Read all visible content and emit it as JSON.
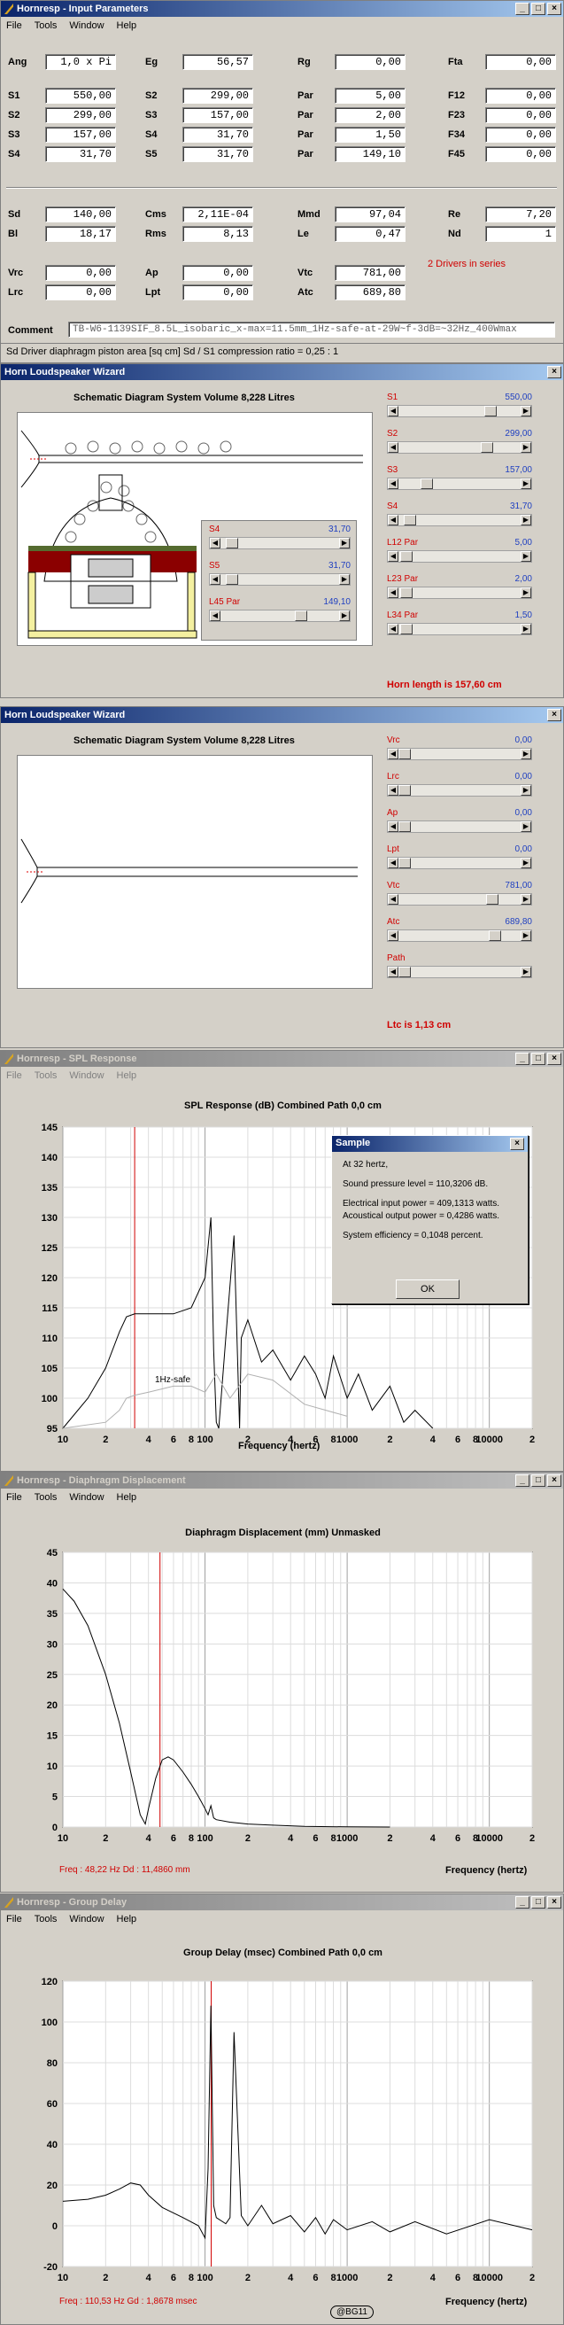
{
  "w1": {
    "title": "Hornresp - Input Parameters",
    "menu": [
      "File",
      "Tools",
      "Window",
      "Help"
    ],
    "params": [
      {
        "row": 0,
        "col": 0,
        "label": "Ang",
        "value": "1,0 x Pi"
      },
      {
        "row": 0,
        "col": 1,
        "label": "Eg",
        "value": "56,57"
      },
      {
        "row": 0,
        "col": 2,
        "label": "Rg",
        "value": "0,00"
      },
      {
        "row": 0,
        "col": 3,
        "label": "Fta",
        "value": "0,00"
      },
      {
        "row": 1,
        "col": 0,
        "label": "S1",
        "value": "550,00"
      },
      {
        "row": 1,
        "col": 1,
        "label": "S2",
        "value": "299,00"
      },
      {
        "row": 1,
        "col": 2,
        "label": "Par",
        "value": "5,00"
      },
      {
        "row": 1,
        "col": 3,
        "label": "F12",
        "value": "0,00"
      },
      {
        "row": 2,
        "col": 0,
        "label": "S2",
        "value": "299,00"
      },
      {
        "row": 2,
        "col": 1,
        "label": "S3",
        "value": "157,00"
      },
      {
        "row": 2,
        "col": 2,
        "label": "Par",
        "value": "2,00"
      },
      {
        "row": 2,
        "col": 3,
        "label": "F23",
        "value": "0,00"
      },
      {
        "row": 3,
        "col": 0,
        "label": "S3",
        "value": "157,00"
      },
      {
        "row": 3,
        "col": 1,
        "label": "S4",
        "value": "31,70"
      },
      {
        "row": 3,
        "col": 2,
        "label": "Par",
        "value": "1,50"
      },
      {
        "row": 3,
        "col": 3,
        "label": "F34",
        "value": "0,00"
      },
      {
        "row": 4,
        "col": 0,
        "label": "S4",
        "value": "31,70"
      },
      {
        "row": 4,
        "col": 1,
        "label": "S5",
        "value": "31,70"
      },
      {
        "row": 4,
        "col": 2,
        "label": "Par",
        "value": "149,10"
      },
      {
        "row": 4,
        "col": 3,
        "label": "F45",
        "value": "0,00"
      },
      {
        "row": 5,
        "col": 0,
        "label": "Sd",
        "value": "140,00"
      },
      {
        "row": 5,
        "col": 1,
        "label": "Cms",
        "value": "2,11E-04"
      },
      {
        "row": 5,
        "col": 2,
        "label": "Mmd",
        "value": "97,04"
      },
      {
        "row": 5,
        "col": 3,
        "label": "Re",
        "value": "7,20"
      },
      {
        "row": 6,
        "col": 0,
        "label": "Bl",
        "value": "18,17"
      },
      {
        "row": 6,
        "col": 1,
        "label": "Rms",
        "value": "8,13"
      },
      {
        "row": 6,
        "col": 2,
        "label": "Le",
        "value": "0,47"
      },
      {
        "row": 6,
        "col": 3,
        "label": "Nd",
        "value": "1"
      },
      {
        "row": 7,
        "col": 0,
        "label": "Vrc",
        "value": "0,00"
      },
      {
        "row": 7,
        "col": 1,
        "label": "Ap",
        "value": "0,00"
      },
      {
        "row": 7,
        "col": 2,
        "label": "Vtc",
        "value": "781,00"
      },
      {
        "row": 8,
        "col": 0,
        "label": "Lrc",
        "value": "0,00"
      },
      {
        "row": 8,
        "col": 1,
        "label": "Lpt",
        "value": "0,00"
      },
      {
        "row": 8,
        "col": 2,
        "label": "Atc",
        "value": "689,80"
      }
    ],
    "drivers_note": "2 Drivers in series",
    "comment_label": "Comment",
    "comment": "TB-W6-1139SIF_8.5L_isobaric_x-max=11.5mm_1Hz-safe-at-29W~f-3dB=~32Hz_400Wmax",
    "status": "Sd   Driver diaphragm piston area  [sq cm]   Sd / S1 compression ratio = 0,25 : 1"
  },
  "w2": {
    "title": "Horn Loudspeaker Wizard",
    "diagram_title": "Schematic Diagram   System Volume 8,228 Litres",
    "sliders_right": [
      {
        "label": "S1",
        "value": "550,00",
        "pos": 0.78
      },
      {
        "label": "S2",
        "value": "299,00",
        "pos": 0.75
      },
      {
        "label": "S3",
        "value": "157,00",
        "pos": 0.2
      },
      {
        "label": "S4",
        "value": "31,70",
        "pos": 0.05
      },
      {
        "label": "L12  Par",
        "value": "5,00",
        "pos": 0.02
      },
      {
        "label": "L23  Par",
        "value": "2,00",
        "pos": 0.02
      },
      {
        "label": "L34  Par",
        "value": "1,50",
        "pos": 0.02
      }
    ],
    "sliders_inner": [
      {
        "label": "S4",
        "value": "31,70",
        "pos": 0.05
      },
      {
        "label": "S5",
        "value": "31,70",
        "pos": 0.05
      },
      {
        "label": "L45  Par",
        "value": "149,10",
        "pos": 0.7
      }
    ],
    "horn_length": "Horn length is 157,60 cm"
  },
  "w3": {
    "title": "Horn Loudspeaker Wizard",
    "diagram_title": "Schematic Diagram   System Volume 8,228 Litres",
    "sliders": [
      {
        "label": "Vrc",
        "value": "0,00",
        "pos": 0.0
      },
      {
        "label": "Lrc",
        "value": "0,00",
        "pos": 0.0
      },
      {
        "label": "Ap",
        "value": "0,00",
        "pos": 0.0
      },
      {
        "label": "Lpt",
        "value": "0,00",
        "pos": 0.0
      },
      {
        "label": "Vtc",
        "value": "781,00",
        "pos": 0.8
      },
      {
        "label": "Atc",
        "value": "689,80",
        "pos": 0.82
      },
      {
        "label": "Path",
        "value": "",
        "pos": 0.0
      }
    ],
    "ltc": "Ltc is 1,13 cm"
  },
  "w4": {
    "title": "Hornresp - SPL Response",
    "menu": [
      "File",
      "Tools",
      "Window",
      "Help"
    ],
    "chart_title": "SPL Response (dB)   Combined   Path 0,0 cm",
    "xlabel": "Frequency (hertz)",
    "annotation": "1Hz-safe",
    "popup": {
      "title": "Sample",
      "l1": "At 32 hertz,",
      "l2": "Sound pressure level = 110,3206 dB.",
      "l3": "Electrical input power = 409,1313 watts.",
      "l4": "Acoustical output power = 0,4286 watts.",
      "l5": "System efficiency = 0,1048 percent.",
      "ok": "OK"
    }
  },
  "w5": {
    "title": "Hornresp - Diaphragm Displacement",
    "menu": [
      "File",
      "Tools",
      "Window",
      "Help"
    ],
    "chart_title": "Diaphragm Displacement (mm)   Unmasked",
    "xlabel": "Frequency (hertz)",
    "readout": "Freq : 48,22 Hz    Dd : 11,4860 mm"
  },
  "w6": {
    "title": "Hornresp - Group Delay",
    "menu": [
      "File",
      "Tools",
      "Window",
      "Help"
    ],
    "chart_title": "Group Delay (msec)   Combined   Path 0,0 cm",
    "xlabel": "Frequency (hertz)",
    "readout": "Freq : 110,53 Hz    Gd : 1,8678 msec",
    "watermark": "@BG11"
  },
  "chart_data": [
    {
      "type": "line",
      "title": "SPL Response (dB)   Combined   Path 0,0 cm",
      "xlabel": "Frequency (hertz)",
      "ylabel": "",
      "xscale": "log",
      "xlim": [
        10,
        20000
      ],
      "ylim": [
        95,
        145
      ],
      "xticks": [
        "10",
        "20",
        "50",
        "100",
        "200",
        "500",
        "1000",
        "2000",
        "5000",
        "10000",
        "20000"
      ],
      "xtick_labels": [
        "10",
        "2",
        "4",
        "6",
        "8",
        "100",
        "2",
        "4",
        "6",
        "8",
        "1000",
        "2",
        "4",
        "6",
        "8",
        "10000",
        "2"
      ],
      "yticks": [
        95,
        100,
        105,
        110,
        115,
        120,
        125,
        130,
        135,
        140,
        145
      ],
      "marker_x": 32,
      "series": [
        {
          "x": [
            10,
            15,
            20,
            25,
            28,
            32,
            40,
            60,
            80,
            100,
            110,
            115,
            120,
            125,
            140,
            160,
            175,
            180,
            200,
            250,
            300,
            400,
            500,
            600,
            700,
            800,
            1000,
            1200,
            1500,
            2000,
            2500,
            3000,
            4000
          ],
          "y": [
            95,
            100,
            105,
            111,
            113.5,
            114,
            114,
            114,
            115,
            120,
            130,
            108,
            96,
            95,
            110,
            127,
            95,
            110,
            113,
            106,
            108,
            103,
            107,
            104,
            100,
            107,
            100,
            104,
            98,
            102,
            96,
            98,
            95
          ]
        },
        {
          "x": [
            10,
            20,
            25,
            28,
            32,
            40,
            60,
            80,
            100,
            120,
            150,
            200,
            300,
            500,
            1000
          ],
          "y": [
            95,
            96,
            98,
            100,
            100.5,
            101,
            102,
            102,
            101,
            104,
            100,
            104,
            103,
            99,
            97
          ]
        }
      ]
    },
    {
      "type": "line",
      "title": "Diaphragm Displacement (mm)   Unmasked",
      "xlabel": "Frequency (hertz)",
      "ylabel": "",
      "xscale": "log",
      "xlim": [
        10,
        20000
      ],
      "ylim": [
        0,
        45
      ],
      "yticks": [
        0,
        5,
        10,
        15,
        20,
        25,
        30,
        35,
        40,
        45
      ],
      "marker_x": 48.22,
      "series": [
        {
          "x": [
            10,
            12,
            15,
            20,
            25,
            30,
            35,
            38,
            40,
            45,
            50,
            55,
            60,
            70,
            80,
            90,
            100,
            105,
            110,
            115,
            120,
            150,
            200,
            300,
            500,
            1000,
            2000
          ],
          "y": [
            39,
            37,
            33,
            25,
            17,
            9,
            2,
            0.5,
            3,
            8,
            11,
            11.5,
            11,
            9,
            7,
            5,
            3,
            2,
            3.5,
            1.5,
            1.2,
            0.8,
            0.5,
            0.3,
            0.1,
            0.03,
            0
          ]
        }
      ]
    },
    {
      "type": "line",
      "title": "Group Delay (msec)   Combined   Path 0,0 cm",
      "xlabel": "Frequency (hertz)",
      "ylabel": "",
      "xscale": "log",
      "xlim": [
        10,
        20000
      ],
      "ylim": [
        -20,
        120
      ],
      "yticks": [
        -20,
        0,
        20,
        40,
        60,
        80,
        100,
        120
      ],
      "marker_x": 110.53,
      "series": [
        {
          "x": [
            10,
            15,
            20,
            25,
            30,
            35,
            40,
            50,
            70,
            90,
            100,
            105,
            110,
            115,
            120,
            140,
            150,
            160,
            180,
            200,
            250,
            300,
            400,
            500,
            600,
            700,
            800,
            1000,
            1500,
            2000,
            3000,
            5000,
            10000,
            20000
          ],
          "y": [
            12,
            13,
            15,
            18,
            21,
            20,
            15,
            9,
            4,
            0,
            -6,
            28,
            108,
            10,
            4,
            1,
            4,
            95,
            5,
            0,
            10,
            1,
            5,
            -3,
            4,
            -4,
            3,
            -2,
            2,
            -3,
            2,
            -4,
            3,
            -2
          ]
        }
      ]
    }
  ]
}
